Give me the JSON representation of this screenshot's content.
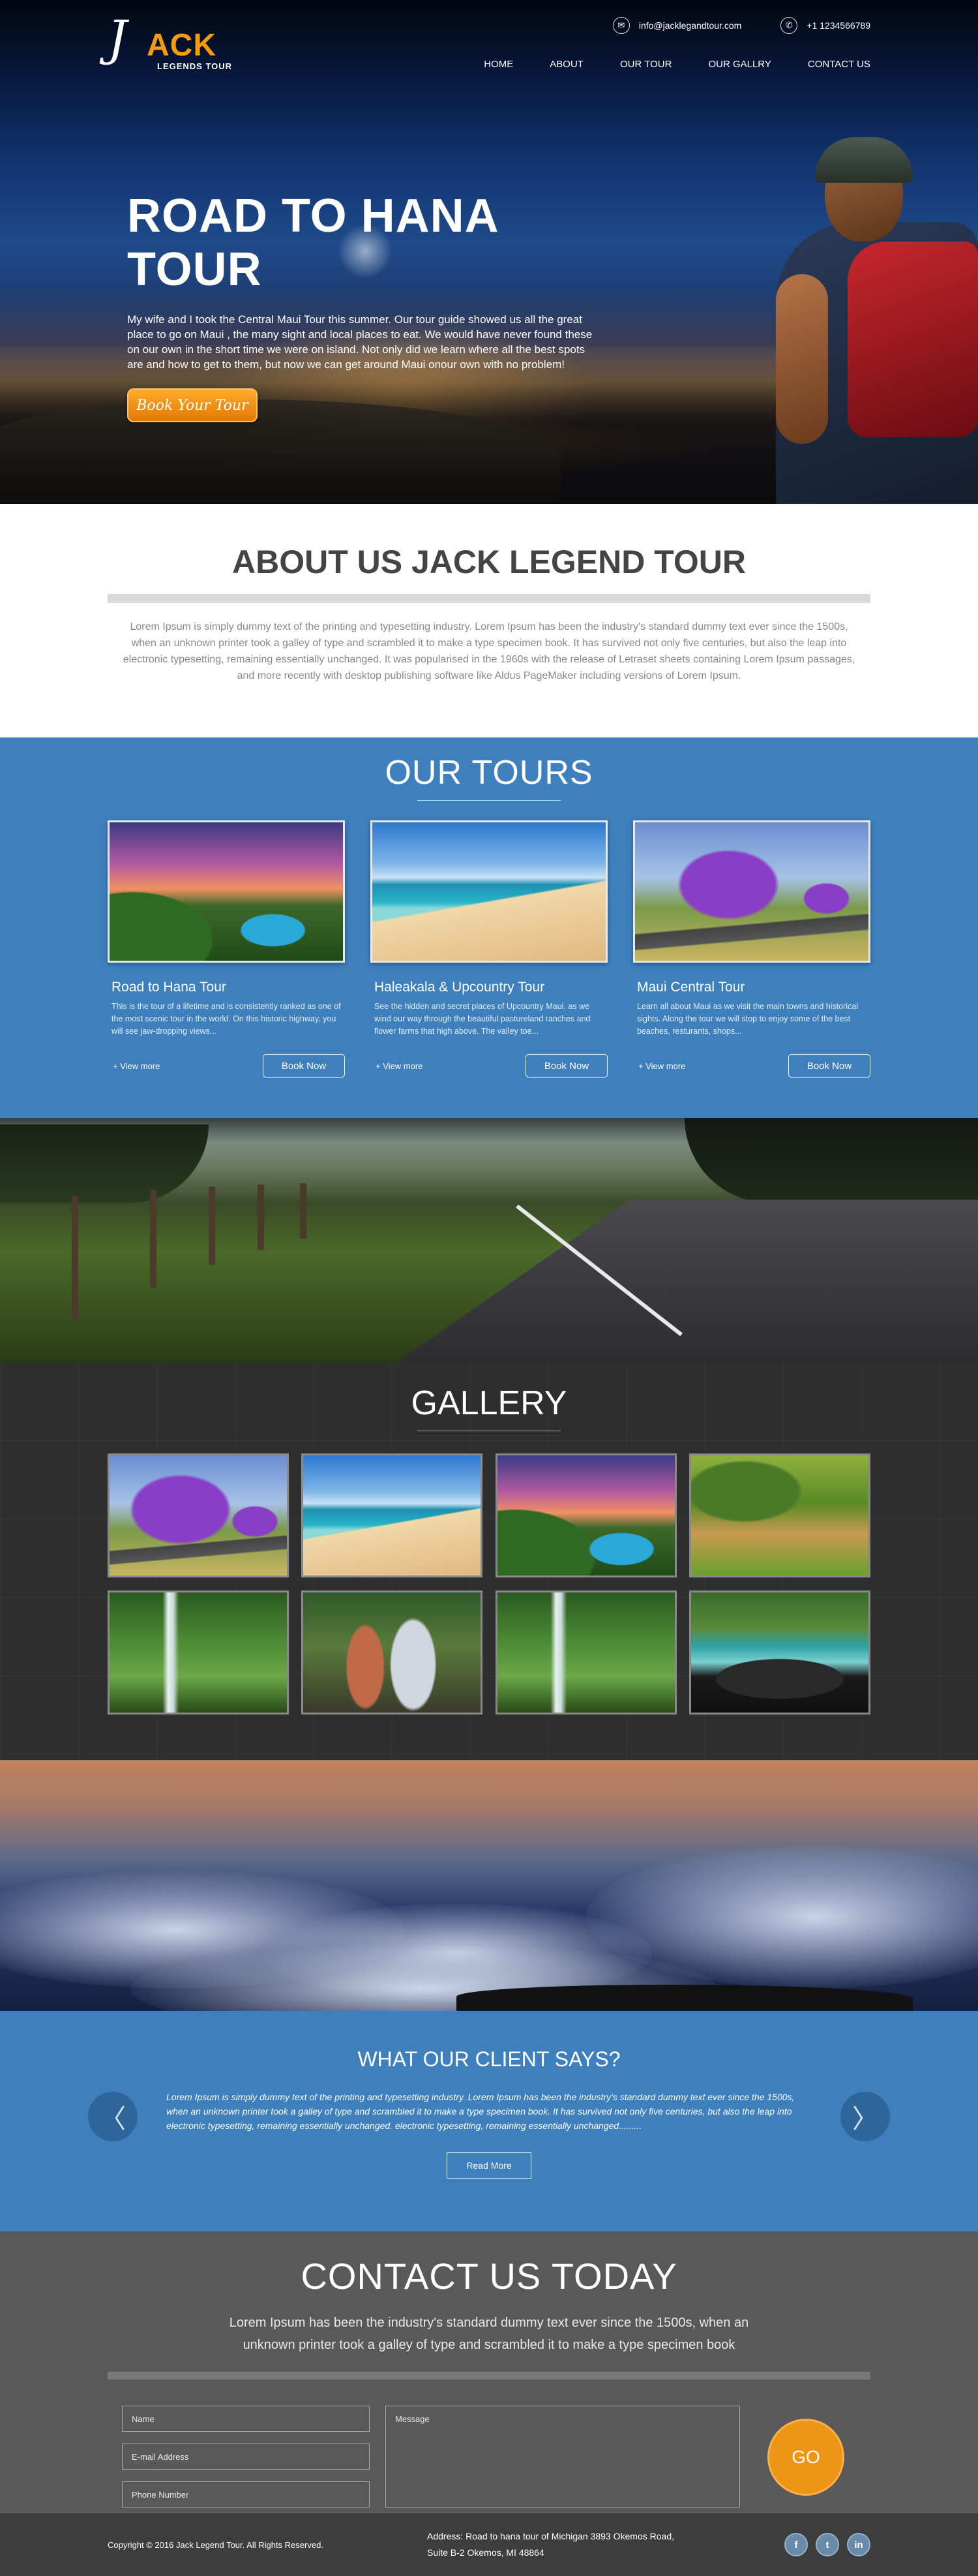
{
  "header": {
    "logo_j": "J",
    "logo_ack": "ACK",
    "logo_sub": "LEGENDS TOUR",
    "email": "info@jacklegandtour.com",
    "phone": "+1 1234566789",
    "nav": [
      "HOME",
      "ABOUT",
      "OUR TOUR",
      "OUR GALLRY",
      "CONTACT US"
    ]
  },
  "hero": {
    "title": "ROAD TO HANA TOUR",
    "text": "My wife and I took the Central Maui Tour this summer. Our tour guide showed us all the great place to go on Maui , the many sight and local places to eat. We would have never found these on our own in the short time we were on island. Not only did we learn where all the best spots are and how to get to them, but now we can get around Maui onour own with no problem!",
    "button": "Book Your Tour"
  },
  "about": {
    "title": "ABOUT US JACK LEGEND TOUR",
    "text": "Lorem Ipsum is simply dummy text of the printing and typesetting industry. Lorem Ipsum has been the industry's standard dummy text ever since the 1500s, when an unknown printer took a galley of type and scrambled it to make a type specimen book. It has survived not only five centuries, but also the leap into electronic typesetting, remaining essentially unchanged. It was popularised in the 1960s with the release of Letraset sheets containing Lorem Ipsum passages, and more recently with desktop publishing software like Aldus PageMaker including versions of Lorem Ipsum."
  },
  "tours": {
    "title": "OUR TOURS",
    "items": [
      {
        "title": "Road to Hana Tour",
        "text": "This is the tour of a lifetime and is consistently ranked as one of the most scenic tour in the world. On this historic highway, you will see jaw-dropping views...",
        "view": "+ View more",
        "button": "Book Now"
      },
      {
        "title": "Haleakala & Upcountry Tour",
        "text": "See the hidden and secret places of Upcountry Maui, as we wind our way through the beautiful pastureland ranches and flower farms that high above. The valley toe...",
        "view": "+ View more",
        "button": "Book Now"
      },
      {
        "title": "Maui Central Tour",
        "text": "Learn all about Maui as we visit the main towns and historical sights. Along the tour we will stop to enjoy some of the best beaches, resturants, shops...",
        "view": "+ View more",
        "button": "Book Now"
      }
    ]
  },
  "gallery": {
    "title": "GALLERY"
  },
  "testimonials": {
    "title": "WHAT OUR CLIENT SAYS?",
    "text": "Lorem Ipsum is simply dummy text of the printing and typesetting industry. Lorem Ipsum has been the industry's standard dummy text ever since the 1500s, when an unknown printer took a galley of type and scrambled it to make a type specimen book. It has survived not only five centuries, but also the leap into electronic typesetting, remaining essentially unchanged. electronic typesetting, remaining essentially unchanged.........",
    "button": "Read More",
    "prev": "〈",
    "next": "〉"
  },
  "contact": {
    "title": "CONTACT US TODAY",
    "lead": "Lorem Ipsum has been the industry's standard dummy text ever since the 1500s, when an unknown printer took a galley of type and scrambled it to make a type specimen book",
    "name_placeholder": "Name",
    "email_placeholder": "E-mail Address",
    "phone_placeholder": "Phone Number",
    "message_placeholder": "Message",
    "submit": "GO"
  },
  "footer": {
    "copyright": "Copyright © 2016 Jack Legend Tour.  All Rights Reserved.",
    "address_line1": "Address: Road to hana tour of Michigan 3893 Okemos Road,",
    "address_line2": "Suite B-2 Okemos, MI 48864",
    "social": [
      "f",
      "t",
      "in"
    ]
  },
  "colors": {
    "accent": "#ee9417",
    "blue": "#3e7fbd",
    "dark": "#2e2e2e"
  }
}
